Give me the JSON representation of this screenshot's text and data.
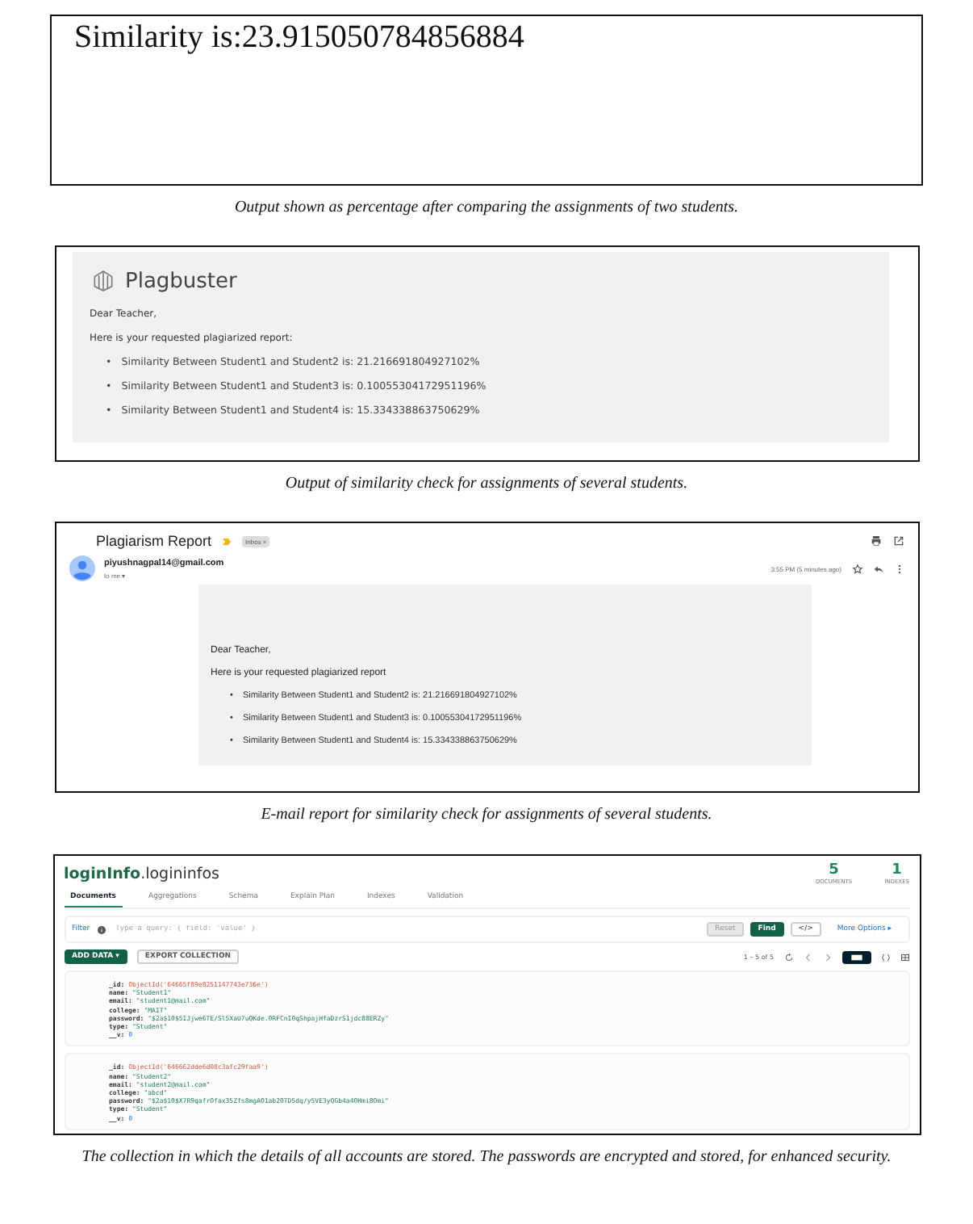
{
  "figures": [
    {
      "kind": "console",
      "output": "Similarity is:23.915050784856884",
      "caption": "Output shown as percentage after comparing the assignments of two students."
    },
    {
      "kind": "report",
      "brand": "Plagbuster",
      "greeting": "Dear Teacher,",
      "intro": "Here is your requested plagiarized report:",
      "bullet": "•",
      "items": [
        "Similarity Between Student1 and Student2 is: 21.216691804927102%",
        "Similarity Between Student1 and Student3 is: 0.10055304172951196%",
        "Similarity Between Student1 and Student4 is: 15.334338863750629%"
      ],
      "caption": "Output of similarity check for assignments of several students."
    },
    {
      "kind": "gmail",
      "subject": "Plagiarism Report",
      "label": "Inbox ×",
      "sender": "piyushnagpal14@gmail.com",
      "recipient": "to me ▾",
      "time": "3:55 PM (5 minutes ago)",
      "greeting": "Dear Teacher,",
      "intro": "Here is your requested plagiarized report",
      "bullet": "•",
      "items": [
        "Similarity Between Student1 and Student2 is: 21.216691804927102%",
        "Similarity Between Student1 and Student3 is: 0.10055304172951196%",
        "Similarity Between Student1 and Student4 is: 15.334338863750629%"
      ],
      "caption": "E-mail report for similarity check for assignments of several students."
    },
    {
      "kind": "mongo",
      "title_db": "loginInfo",
      "title_coll": ".logininfos",
      "stats": [
        {
          "value": "5",
          "label": "DOCUMENTS"
        },
        {
          "value": "1",
          "label": "INDEXES"
        }
      ],
      "tabs": [
        {
          "label": "Documents",
          "selected": true
        },
        {
          "label": "Aggregations",
          "selected": false
        },
        {
          "label": "Schema",
          "selected": false
        },
        {
          "label": "Explain Plan",
          "selected": false
        },
        {
          "label": "Indexes",
          "selected": false
        },
        {
          "label": "Validation",
          "selected": false
        }
      ],
      "filter_label": "Filter",
      "query_placeholder": "Type a query: { field: 'value' }",
      "reset": "Reset",
      "find": "Find",
      "code_button": "</>",
      "more_options": "More Options ▸",
      "add_data": "ADD DATA ▾",
      "export": "EXPORT COLLECTION",
      "range": "1 – 5 of 5",
      "documents": [
        {
          "fields": [
            {
              "key": "_id:",
              "value": "ObjectId('64665f89e8251147743e736e')",
              "kind": "objectid"
            },
            {
              "key": "name:",
              "value": "\"Student1\"",
              "kind": "string"
            },
            {
              "key": "email:",
              "value": "\"student1@mail.com\"",
              "kind": "string"
            },
            {
              "key": "college:",
              "value": "\"MAIT\"",
              "kind": "string"
            },
            {
              "key": "password:",
              "value": "\"$2a$10$5IJjwe6TE/Sl5XaU7uQKde.0RFCnI0qShpajHfaDzrS1jdc88ERZy\"",
              "kind": "string"
            },
            {
              "key": "type:",
              "value": "\"Student\"",
              "kind": "string"
            },
            {
              "key": "__v:",
              "value": "0",
              "kind": "number"
            }
          ]
        },
        {
          "fields": [
            {
              "key": "_id:",
              "value": "ObjectId('646662dde6d08c3afc29faa9')",
              "kind": "objectid"
            },
            {
              "key": "name:",
              "value": "\"Student2\"",
              "kind": "string"
            },
            {
              "key": "email:",
              "value": "\"student2@mail.com\"",
              "kind": "string"
            },
            {
              "key": "college:",
              "value": "\"abcd\"",
              "kind": "string"
            },
            {
              "key": "password:",
              "value": "\"$2a$10$X7R9qafrOfax35Zfs8mgAO1ab20TD5dq/y5VE3yQGb4a40Hmi8Omi\"",
              "kind": "string"
            },
            {
              "key": "type:",
              "value": "\"Student\"",
              "kind": "string"
            },
            {
              "key": "__v:",
              "value": "0",
              "kind": "number"
            }
          ]
        }
      ],
      "caption": "The collection in which the details of all accounts are stored. The passwords are encrypted and stored, for enhanced security."
    }
  ]
}
